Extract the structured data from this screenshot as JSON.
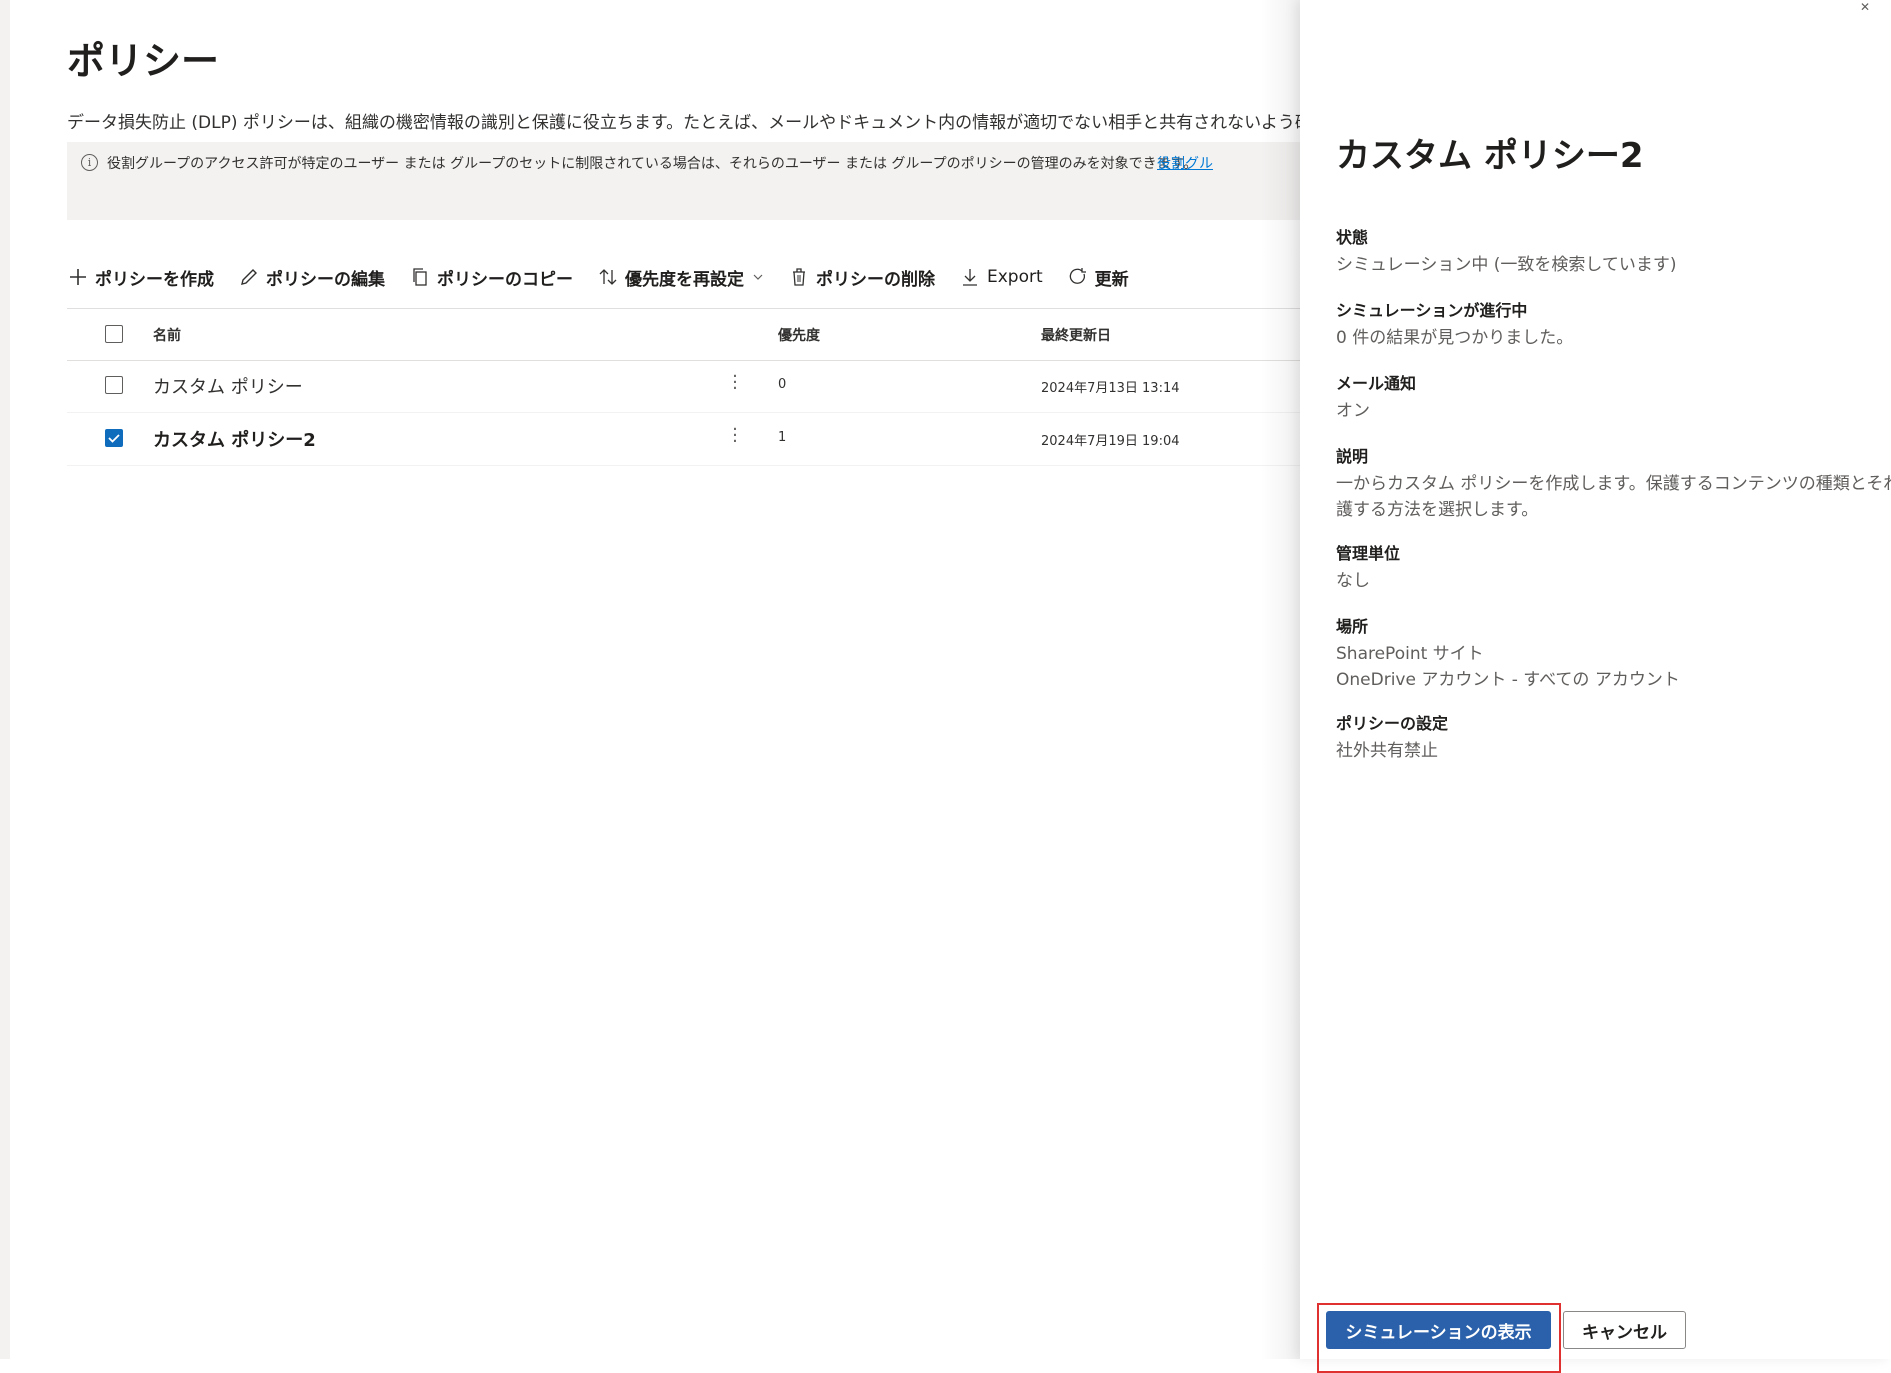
{
  "page": {
    "title": "ポリシー",
    "description": "データ損失防止 (DLP) ポリシーは、組織の機密情報の識別と保護に役立ちます。たとえば、メールやドキュメント内の情報が適切でない相手と共有されないよう確認",
    "info_text": "役割グループのアクセス許可が特定のユーザー または グループのセットに制限されている場合は、それらのユーザー または グループのポリシーの管理のみを対象できます。",
    "info_link": "役割グル"
  },
  "toolbar": {
    "create": "ポリシーを作成",
    "edit": "ポリシーの編集",
    "copy": "ポリシーのコピー",
    "reorder": "優先度を再設定",
    "delete": "ポリシーの削除",
    "export": "Export",
    "refresh": "更新"
  },
  "table": {
    "headers": {
      "name": "名前",
      "priority": "優先度",
      "last_modified": "最終更新日"
    },
    "rows": [
      {
        "name": "カスタム ポリシー",
        "priority": "0",
        "last_modified": "2024年7月13日 13:14",
        "selected": false
      },
      {
        "name": "カスタム ポリシー2",
        "priority": "1",
        "last_modified": "2024年7月19日 19:04",
        "selected": true
      }
    ]
  },
  "panel": {
    "title": "カスタム ポリシー2",
    "fields": [
      {
        "label": "状態",
        "value": "シミュレーション中 (一致を検索しています)"
      },
      {
        "label": "シミュレーションが進行中",
        "value": "0 件の結果が見つかりました。"
      },
      {
        "label": "メール通知",
        "value": "オン"
      },
      {
        "label": "説明",
        "value": "一からカスタム ポリシーを作成します。保護するコンテンツの種類とそれ",
        "value2": "護する方法を選択します。"
      },
      {
        "label": "管理単位",
        "value": "なし"
      },
      {
        "label": "場所",
        "value": "SharePoint サイト",
        "value2": "OneDrive アカウント - すべての アカウント"
      },
      {
        "label": "ポリシーの設定",
        "value": "社外共有禁止"
      }
    ],
    "primary_button": "シミュレーションの表示",
    "cancel_button": "キャンセル"
  },
  "colors": {
    "primary": "#2b61aa",
    "highlight": "#e03131",
    "checkbox_checked": "#0f6cbd"
  }
}
